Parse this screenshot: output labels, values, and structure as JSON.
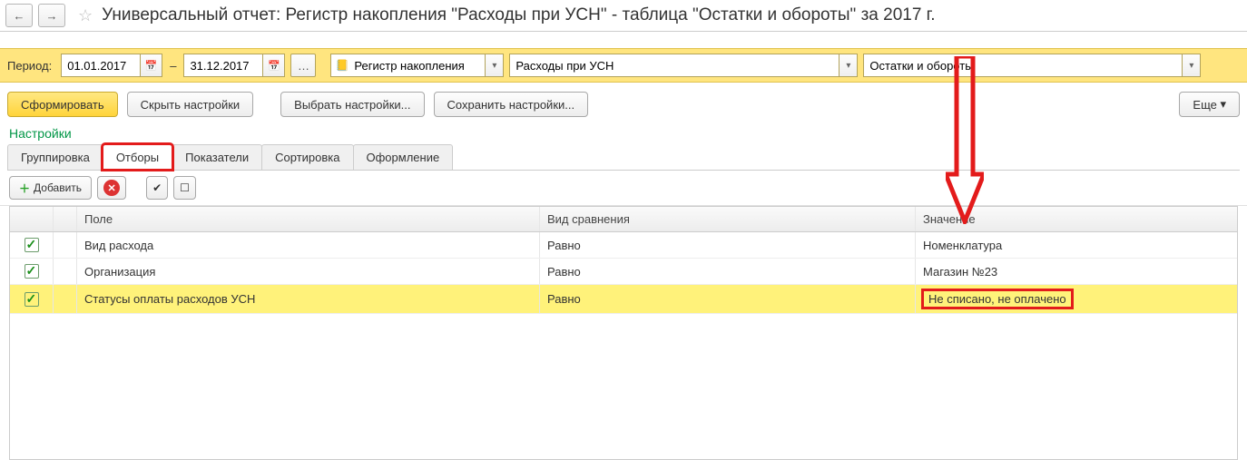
{
  "header": {
    "title": "Универсальный отчет: Регистр накопления \"Расходы при УСН\" - таблица \"Остатки и обороты\" за 2017 г."
  },
  "period": {
    "label": "Период:",
    "from": "01.01.2017",
    "to": "31.12.2017",
    "register_type": "Регистр накопления",
    "register": "Расходы при УСН",
    "table": "Остатки и обороты"
  },
  "actions": {
    "generate": "Сформировать",
    "hide_settings": "Скрыть настройки",
    "choose_settings": "Выбрать настройки...",
    "save_settings": "Сохранить настройки...",
    "more": "Еще"
  },
  "settings": {
    "section_title": "Настройки",
    "tabs": {
      "grouping": "Группировка",
      "filters": "Отборы",
      "indicators": "Показатели",
      "sorting": "Сортировка",
      "design": "Оформление"
    }
  },
  "filter_toolbar": {
    "add": "Добавить"
  },
  "grid": {
    "headers": {
      "field": "Поле",
      "comparison": "Вид сравнения",
      "value": "Значение"
    },
    "rows": [
      {
        "checked": true,
        "field": "Вид расхода",
        "comparison": "Равно",
        "value": "Номенклатура"
      },
      {
        "checked": true,
        "field": "Организация",
        "comparison": "Равно",
        "value": "Магазин №23"
      },
      {
        "checked": true,
        "field": "Статусы оплаты расходов УСН",
        "comparison": "Равно",
        "value": "Не списано, не оплачено"
      }
    ]
  }
}
